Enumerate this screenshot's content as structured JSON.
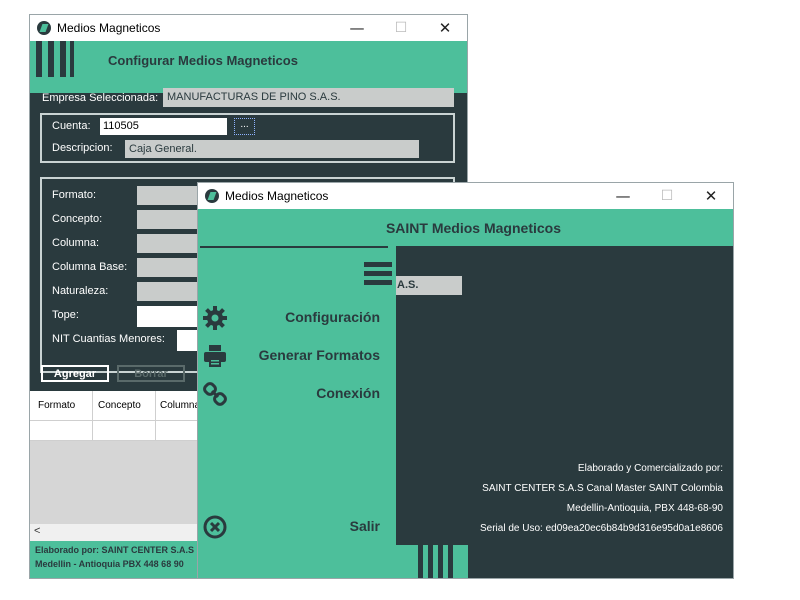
{
  "back_window": {
    "title": "Medios Magneticos",
    "header": "Configurar Medios Magneticos",
    "empresa_label": "Empresa Seleccionada:",
    "empresa_value": "MANUFACTURAS DE PINO S.A.S.",
    "cuenta_label": "Cuenta:",
    "cuenta_value": "110505",
    "browse_label": "...",
    "descripcion_label": "Descripcion:",
    "descripcion_value": "Caja General.",
    "fields": {
      "formato": "Formato:",
      "concepto": "Concepto:",
      "columna": "Columna:",
      "columna_base": "Columna Base:",
      "naturaleza": "Naturaleza:",
      "tope": "Tope:",
      "nit": "NIT Cuantias Menores:"
    },
    "agregar_label": "Agregar",
    "borrar_label": "Borrar",
    "grid_columns": [
      "Formato",
      "Concepto",
      "Columna"
    ],
    "scroll_left": "<",
    "footer_line1": "Elaborado por: SAINT CENTER S.A.S",
    "footer_line2": "Medellin - Antioquia PBX 448 68 90"
  },
  "front_window": {
    "title": "Medios Magneticos",
    "header": "SAINT Medios Magneticos",
    "menu_icon": "hamburger-icon",
    "menu": {
      "configuracion": "Configuración",
      "generar": "Generar Formatos",
      "conexion": "Conexión",
      "salir": "Salir"
    },
    "behind_text": "A.S.",
    "footer_info": {
      "line1": "Elaborado y Comercializado por:",
      "line2": "SAINT CENTER S.A.S Canal Master SAINT Colombia",
      "line3": "Medellin-Antioquia, PBX 448-68-90",
      "line4": "Serial de Uso: ed09ea20ec6b84b9d316e95d0a1e8606"
    }
  },
  "window_controls": {
    "minimize": "—",
    "maximize": "☐",
    "close": "✕"
  },
  "colors": {
    "accent": "#4dbf9b",
    "dark": "#2a3a3e",
    "field": "#c9cccb"
  }
}
